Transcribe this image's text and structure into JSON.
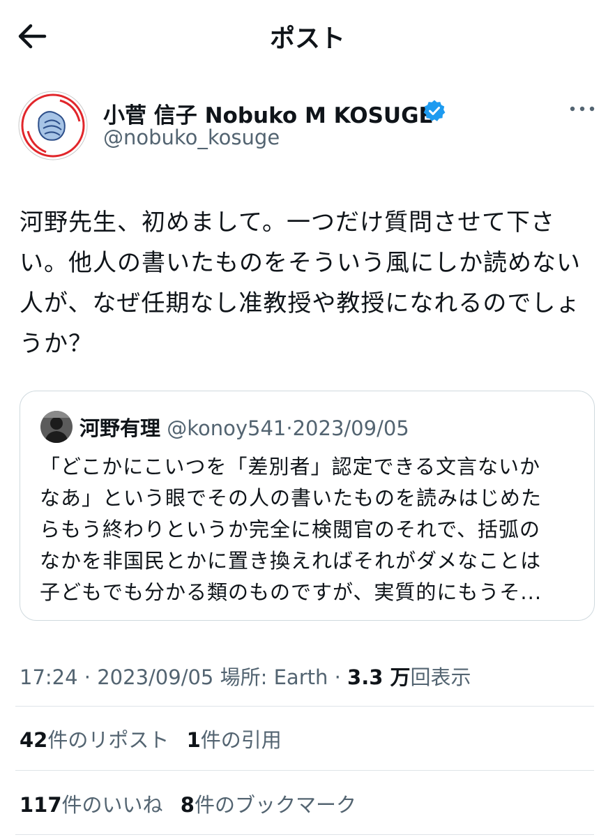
{
  "header": {
    "title": "ポスト"
  },
  "author": {
    "name": "小菅 信子 Nobuko M KOSUGE",
    "handle": "@nobuko_kosuge",
    "verified": true
  },
  "tweet": {
    "lines": [
      "河野先生、初めまして。一つだけ質問させて下さ",
      "い。他人の書いたものをそういう風にしか読めない",
      "人が、なぜ任期なし准教授や教授になれるのでしょ",
      "うか？"
    ]
  },
  "quote": {
    "name": "河野有理",
    "handle": "@konoy541",
    "separator": "·",
    "date": "2023/09/05",
    "lines": [
      "「どこかにこいつを「差別者」認定できる文言ないか",
      "なあ」という眼でその人の書いたものを読みはじめた",
      "らもう終わりというか完全に検閲官のそれで、括弧の",
      "なかを非国民とかに置き換えればそれがダメなことは",
      "子どもでも分かる類のものですが、実質的にもうそ..."
    ]
  },
  "meta": {
    "time": "17:24",
    "sep": "·",
    "date": "2023/09/05",
    "location": "場所: Earth",
    "views_count": "3.3 万",
    "views_label": "回表示"
  },
  "stats": {
    "reposts_count": "42",
    "reposts_label": "件のリポスト",
    "quotes_count": "1",
    "quotes_label": "件の引用",
    "likes_count": "117",
    "likes_label": "件のいいね",
    "bookmarks_count": "8",
    "bookmarks_label": "件のブックマーク"
  },
  "icons": {
    "back": "arrow-left-icon",
    "verified": "verified-badge-icon",
    "more": "more-horizontal-icon"
  },
  "colors": {
    "text": "#0f1419",
    "secondary": "#536471",
    "verified": "#1d9bf0",
    "border": "#cfd9de"
  }
}
